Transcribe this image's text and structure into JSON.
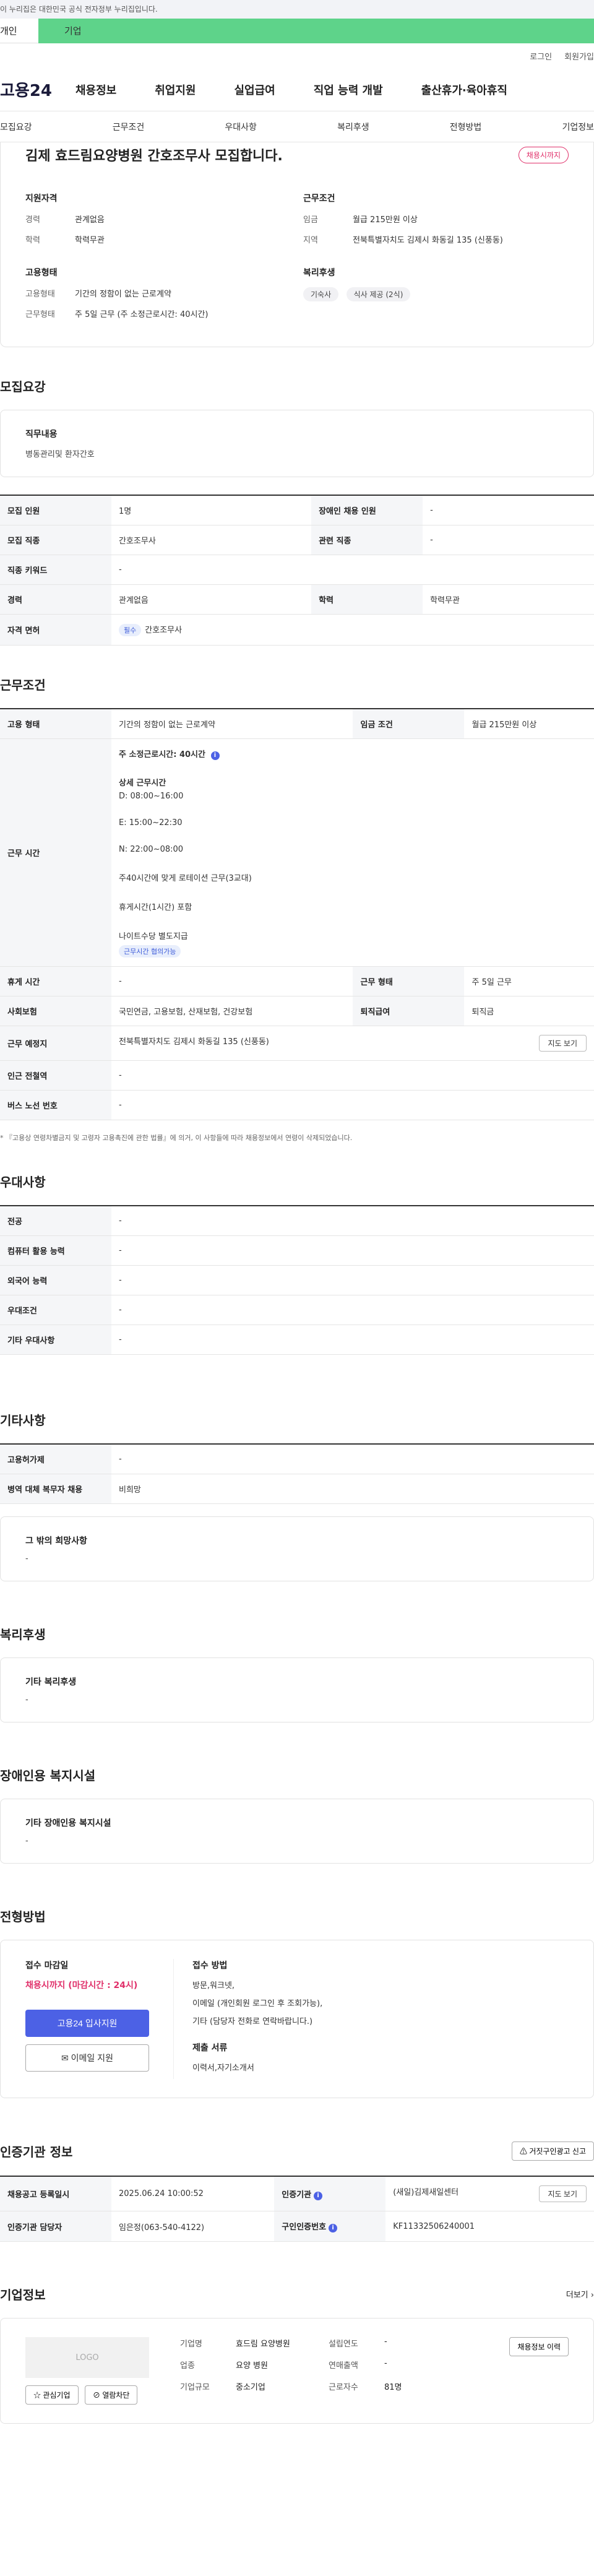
{
  "gov_bar": "이 누리집은 대한민국 공식 전자정부 누리집입니다.",
  "member_tabs": {
    "person": "개인",
    "company": "기업"
  },
  "top_links": [
    "로그인",
    "회원가입"
  ],
  "logo": "고용24",
  "gnb": [
    "채용정보",
    "취업지원",
    "실업급여",
    "직업 능력 개발",
    "출산휴가·육아휴직"
  ],
  "sub_nav": [
    "모집요강",
    "근무조건",
    "우대사항",
    "복리후생",
    "전형방법",
    "기업정보"
  ],
  "job": {
    "title": "김제 효드림요양병원 간호조무사 모집합니다.",
    "badge": "채용시까지"
  },
  "summary": {
    "qual_title": "지원자격",
    "qual": [
      {
        "k": "경력",
        "v": "관계없음"
      },
      {
        "k": "학력",
        "v": "학력무관"
      }
    ],
    "cond_title": "근무조건",
    "cond": [
      {
        "k": "임금",
        "v": "월급 215만원 이상"
      },
      {
        "k": "지역",
        "v": "전북특별자치도 김제시 화동길 135 (신풍동)"
      }
    ],
    "emp_title": "고용형태",
    "emp": [
      {
        "k": "고용형태",
        "v": "기간의 정함이 없는 근로계약"
      },
      {
        "k": "근무형태",
        "v": "주 5일 근무 (주 소정근로시간: 40시간)"
      }
    ],
    "welfare_title": "복리후생",
    "welfare_chips": [
      "기숙사",
      "식사 제공 (2식)"
    ]
  },
  "recruit": {
    "heading": "모집요강",
    "duty_label": "직무내용",
    "duty_text": "병동관리및 환자간호",
    "rows": {
      "people_k": "모집 인원",
      "people_v": "1명",
      "disabled_k": "장애인 채용 인원",
      "disabled_v": "-",
      "job_k": "모집 직종",
      "job_v": "간호조무사",
      "related_k": "관련 직종",
      "related_v": "-",
      "keyword_k": "직종 키워드",
      "keyword_v": "-",
      "career_k": "경력",
      "career_v": "관계없음",
      "edu_k": "학력",
      "edu_v": "학력무관",
      "license_k": "자격 면허",
      "license_badge": "필수",
      "license_v": "간호조무사"
    }
  },
  "work": {
    "heading": "근무조건",
    "emp_k": "고용 형태",
    "emp_v": "기간의 정함이 없는 근로계약",
    "wage_k": "임금 조건",
    "wage_v": "월급 215만원 이상",
    "hours_k": "근무 시간",
    "hours_main": "주 소정근로시간: 40시간",
    "detail_title": "상세 근무시간",
    "shift_d": "D: 08:00~16:00",
    "shift_e": "E: 15:00~22:30",
    "shift_n": "N: 22:00~08:00",
    "rotation": "주40시간에 맞게 로테이션 근무(3교대)",
    "break": "휴게시간(1시간) 포함",
    "night": "나이트수당 별도지급",
    "flex_badge": "근무시간 협의가능",
    "rest_k": "휴게 시간",
    "rest_v": "-",
    "form_k": "근무 형태",
    "form_v": "주 5일 근무",
    "ins_k": "사회보험",
    "ins_v": "국민연금, 고용보험, 산재보험, 건강보험",
    "retire_k": "퇴직급여",
    "retire_v": "퇴직금",
    "place_k": "근무 예정지",
    "place_v": "전북특별자치도 김제시 화동길 135 (신풍동)",
    "map_btn": "지도 보기",
    "subway_k": "인근 전철역",
    "subway_v": "-",
    "bus_k": "버스 노선 번호",
    "bus_v": "-",
    "note": "* 『고용상 연령차별금지 및 고령자 고용촉진에 관한 법률』에 의거, 이 사항들에 따라 채용정보에서 연령이 삭제되었습니다."
  },
  "pref": {
    "heading": "우대사항",
    "rows": [
      {
        "k": "전공",
        "v": "-"
      },
      {
        "k": "컴퓨터 활용 능력",
        "v": "-"
      },
      {
        "k": "외국어 능력",
        "v": "-"
      },
      {
        "k": "우대조건",
        "v": "-"
      },
      {
        "k": "기타 우대사항",
        "v": "-"
      }
    ]
  },
  "etc": {
    "heading": "기타사항",
    "rows": [
      {
        "k": "고용허가제",
        "v": "-"
      },
      {
        "k": "병역 대체 복무자 채용",
        "v": "비희망"
      }
    ],
    "wish_label": "그 밖의 희망사항",
    "wish_text": "-"
  },
  "benefits": {
    "heading": "복리후생",
    "label": "기타 복리후생",
    "text": "-"
  },
  "facility": {
    "heading": "장애인용 복지시설",
    "label": "기타 장애인용 복지시설",
    "text": "-"
  },
  "apply": {
    "heading": "전형방법",
    "deadline_label": "접수 마감일",
    "deadline_value": "채용시까지 (마감시간 : 24시)",
    "btn_apply": "고용24 입사지원",
    "btn_email": "이메일 지원",
    "method_label": "접수 방법",
    "method_1": "방문,워크넷,",
    "method_2": "이메일 (개인회원 로그인 후 조회가능),",
    "method_3": "기타 (담당자 전화로 연락바랍니다.)",
    "docs_label": "제출 서류",
    "docs_text": "이력서,자기소개서"
  },
  "agency": {
    "heading": "인증기관 정보",
    "report_btn": "거짓구인광고 신고",
    "date_k": "채용공고 등록일시",
    "date_v": "2025.06.24 10:00:52",
    "org_k": "인증기관",
    "org_v": "(새일)김제새일센터",
    "map_btn": "지도 보기",
    "manager_k": "인증기관 담당자",
    "manager_v": "임은정(063-540-4122)",
    "num_k": "구인인증번호",
    "num_v": "KF11332506240001"
  },
  "company": {
    "heading": "기업정보",
    "more": "더보기",
    "logo": "LOGO",
    "fav_btn": "관심기업",
    "block_btn": "열람차단",
    "name_k": "기업명",
    "name_v": "효드림 요양병원",
    "year_k": "설립연도",
    "year_v": "-",
    "industry_k": "업종",
    "industry_v": "요양 병원",
    "sales_k": "연매출액",
    "sales_v": "-",
    "size_k": "기업규모",
    "size_v": "중소기업",
    "staff_k": "근로자수",
    "staff_v": "81명",
    "history_btn": "채용정보 이력"
  }
}
